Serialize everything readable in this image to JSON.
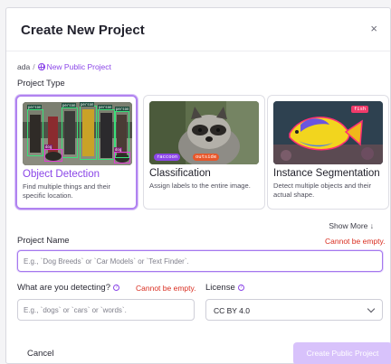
{
  "dialog": {
    "title": "Create New Project",
    "close_glyph": "×"
  },
  "breadcrumb": {
    "workspace": "ada",
    "separator": "/",
    "current": "New Public Project",
    "icon": "globe-icon"
  },
  "project_type": {
    "label": "Project Type",
    "selected": "Object Detection",
    "cards": [
      {
        "title": "Object Detection",
        "description": "Find multiple things and their specific location.",
        "image_labels": [
          "person",
          "person",
          "person",
          "person",
          "person",
          "dog",
          "dog"
        ]
      },
      {
        "title": "Classification",
        "description": "Assign labels to the entire image.",
        "image_labels": [
          "raccoon",
          "outside"
        ]
      },
      {
        "title": "Instance Segmentation",
        "description": "Detect multiple objects and their actual shape.",
        "image_labels": [
          "fish"
        ]
      }
    ],
    "show_more": "Show More ↓"
  },
  "project_name": {
    "label": "Project Name",
    "error": "Cannot be empty.",
    "placeholder": "E.g., `Dog Breeds` or `Car Models` or `Text Finder`.",
    "value": ""
  },
  "detecting": {
    "label": "What are you detecting?",
    "help_glyph": "?",
    "error": "Cannot be empty.",
    "placeholder": "E.g., `dogs` or `cars` or `words`.",
    "value": ""
  },
  "license": {
    "label": "License",
    "help_glyph": "?",
    "selected": "CC BY 4.0"
  },
  "footer": {
    "cancel": "Cancel",
    "create": "Create Public Project"
  },
  "colors": {
    "accent": "#8b46e8",
    "selected_border": "#b183f0",
    "error": "#d92d20",
    "create_button_disabled": "#d8c2fb"
  }
}
